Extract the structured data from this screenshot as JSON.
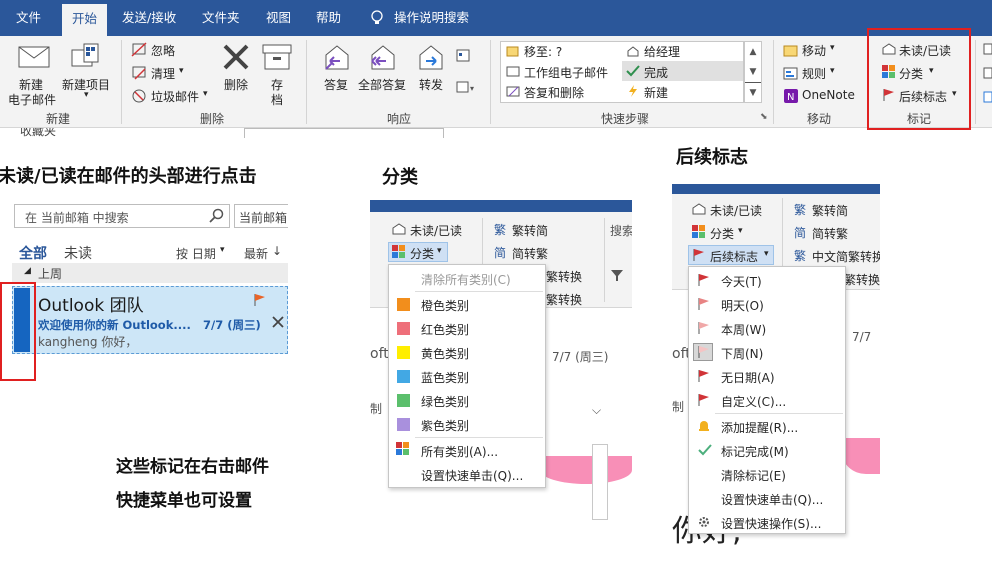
{
  "tabs": [
    "文件",
    "开始",
    "发送/接收",
    "文件夹",
    "视图",
    "帮助"
  ],
  "search_tell": "操作说明搜索",
  "ribbon": {
    "new_email": [
      "新建",
      "电子邮件"
    ],
    "new_items": [
      "新建项目"
    ],
    "group_new": "新建",
    "ignore": "忽略",
    "cleanup": "清理",
    "junk": "垃圾邮件",
    "delete": "删除",
    "archive": [
      "存",
      "档"
    ],
    "group_delete": "删除",
    "reply": "答复",
    "reply_all": "全部答复",
    "forward": "转发",
    "group_respond": "响应",
    "quick_steps": [
      "移至: ?",
      "工作组电子邮件",
      "答复和删除",
      "给经理",
      "完成",
      "新建"
    ],
    "group_quicksteps": "快速步骤",
    "move": "移动",
    "rules": "规则",
    "onenote": "OneNote",
    "group_move": "移动",
    "unread_read": "未读/已读",
    "categorize": "分类",
    "followup": "后续标志",
    "group_tags": "标记",
    "cut_text": "收藏夹"
  },
  "headings": {
    "h1": "未读/已读在邮件的头部进行点击",
    "h2": "分类",
    "h3": "后续标志"
  },
  "maillist": {
    "search_placeholder": "在 当前邮箱 中搜索",
    "scope": "当前邮箱",
    "all": "全部",
    "unread": "未读",
    "by_date": "按 日期",
    "newest": "最新",
    "group": "上周",
    "sender": "Outlook 团队",
    "subject": "欢迎使用你的新 Outlook....",
    "date": "7/7 (周三)",
    "preview": "kangheng 你好，"
  },
  "note_lines": [
    "这些标记在右击邮件",
    "快捷菜单也可设置"
  ],
  "cat_panel": {
    "unread_read": "未读/已读",
    "categorize": "分类",
    "trad_simp": "繁转简",
    "simp_trad": "简转繁",
    "conv": "繁转换",
    "conv2": "繁转换",
    "search_frag": "搜索",
    "menu": [
      "清除所有类别(C)",
      "橙色类别",
      "红色类别",
      "黄色类别",
      "蓝色类别",
      "绿色类别",
      "紫色类别",
      "所有类别(A)...",
      "设置快速单击(Q)..."
    ],
    "bg_frag1": "oft",
    "bg_frag2": "7/7 (周三)",
    "bg_frag3": "制"
  },
  "flag_panel": {
    "unread_read": "未读/已读",
    "categorize": "分类",
    "followup": "后续标志",
    "trad_simp": "繁转简",
    "simp_trad": "简转繁",
    "cn_conv": "中文简繁转换",
    "conv": "繁转换",
    "menu": [
      "今天(T)",
      "明天(O)",
      "本周(W)",
      "下周(N)",
      "无日期(A)",
      "自定义(C)...",
      "添加提醒(R)...",
      "标记完成(M)",
      "清除标记(E)",
      "设置快速单击(Q)...",
      "设置快速操作(S)..."
    ],
    "bg_frag1": "oft",
    "bg_frag2": "7/7",
    "bg_frag3": "制",
    "bg_frag4": "你好,"
  },
  "colors": {
    "accent": "#2b579a",
    "highlight_red": "#e02020",
    "orange": "#f28e1c",
    "red": "#ee6f7a",
    "yellow": "#ffee00",
    "blue": "#42a8e4",
    "green": "#5bbf6c",
    "purple": "#a990dd"
  }
}
